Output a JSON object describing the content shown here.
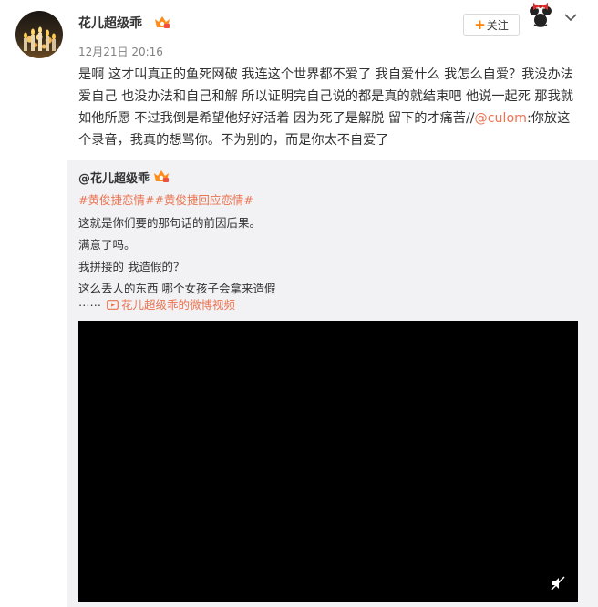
{
  "post": {
    "username": "花儿超级乖",
    "timestamp": "12月21日 20:16",
    "follow_label": "关注",
    "text_before_mention": "是啊 这才叫真正的鱼死网破 我连这个世界都不爱了 我自爱什么 我怎么自爱？我没办法爱自己 也没办法和自己和解 所以证明完自己说的都是真的就结束吧 他说一起死 那我就如他所愿 不过我倒是希望他好好活着 因为死了是解脱 留下的才痛苦//",
    "mention": "@culom",
    "text_after_mention": ":你放这个录音，我真的想骂你。不为别的，而是你太不自爱了"
  },
  "quote": {
    "username": "@花儿超级乖",
    "topics": "#黄俊捷恋情##黄俊捷回应恋情#",
    "lines": [
      "这就是你们要的那句话的前因后果。",
      "满意了吗。",
      "我拼接的 我造假的？",
      "这么丢人的东西 哪个女孩子会拿来造假"
    ],
    "ellipsis": "……",
    "video_link": "花儿超级乖的微博视频"
  },
  "colors": {
    "accent_orange": "#ff8200",
    "link_red": "#eb7350",
    "quote_bg": "#f2f2f5",
    "video_bg": "#000000"
  },
  "icons": {
    "vip": "vip-crown-icon",
    "badge": "minnie-bow-icon",
    "chevron": "chevron-down-icon",
    "video": "video-play-icon",
    "mute": "mute-icon"
  }
}
